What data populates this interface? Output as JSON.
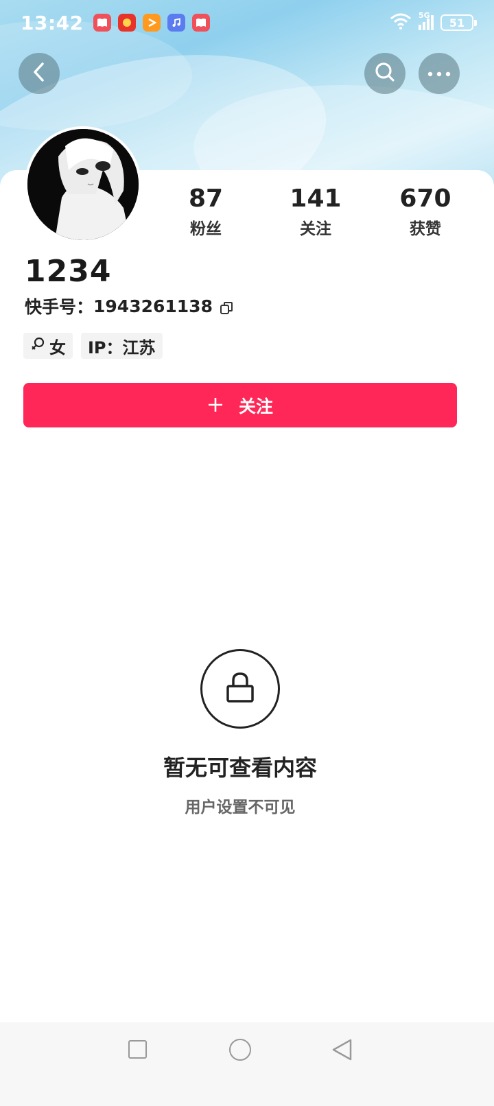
{
  "status_bar": {
    "time": "13:42",
    "network": "5G",
    "battery": "51",
    "app_icons": [
      {
        "name": "book-app-icon",
        "color": "#f0505a"
      },
      {
        "name": "shopping-app-icon",
        "color": "#e8332a"
      },
      {
        "name": "video-app-icon",
        "color": "#ff9a1f"
      },
      {
        "name": "music-app-icon",
        "color": "#5b7cf0"
      },
      {
        "name": "book-app-icon-2",
        "color": "#f0505a"
      }
    ]
  },
  "header": {
    "back_icon": "chevron-left-icon",
    "search_icon": "search-icon",
    "more_icon": "more-icon"
  },
  "profile": {
    "username": "1234",
    "uid_label": "快手号：",
    "uid_value": "1943261138",
    "stats": [
      {
        "value": "87",
        "label": "粉丝"
      },
      {
        "value": "141",
        "label": "关注"
      },
      {
        "value": "670",
        "label": "获赞"
      }
    ],
    "tags": {
      "gender": "女",
      "ip": "IP：江苏"
    },
    "follow_button": "关注"
  },
  "empty_state": {
    "title": "暂无可查看内容",
    "subtitle": "用户设置不可见"
  },
  "colors": {
    "accent": "#fe2757",
    "text": "#222222"
  }
}
